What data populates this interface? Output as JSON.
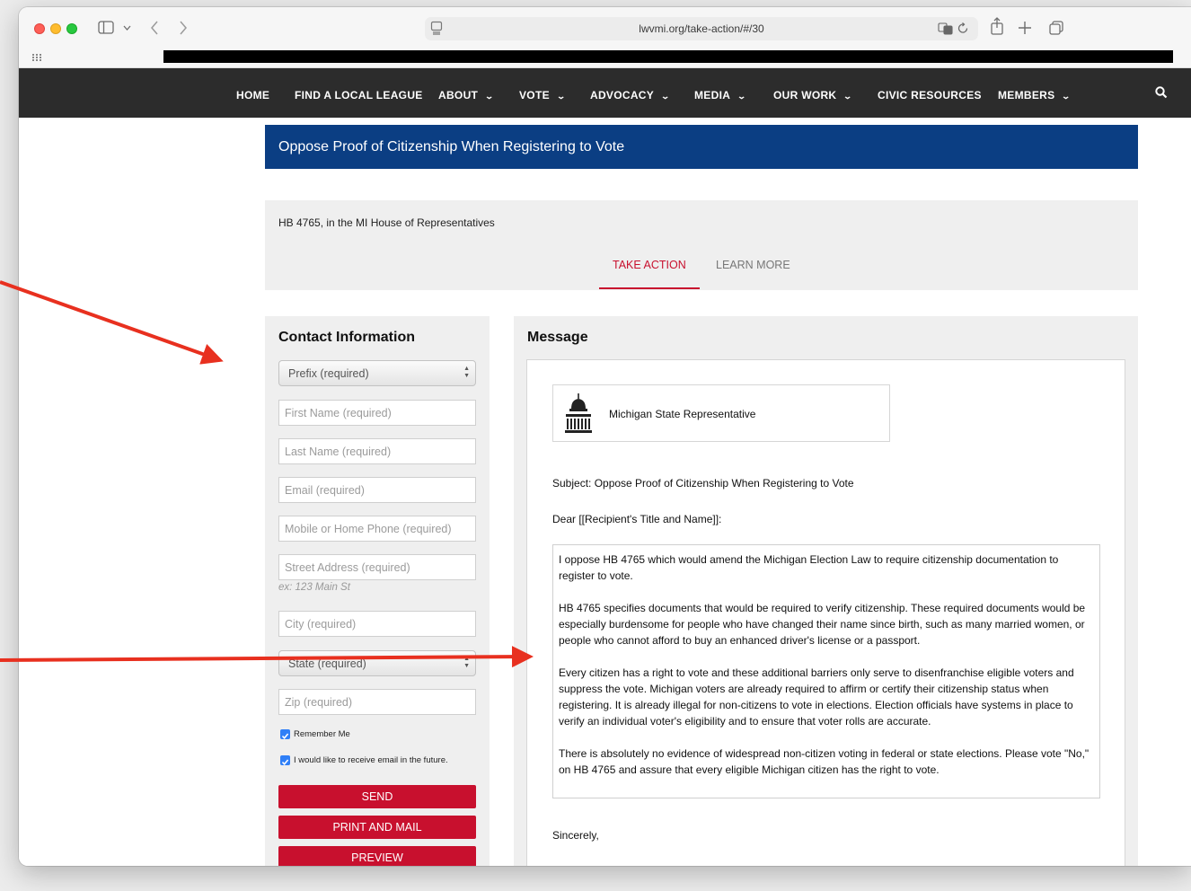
{
  "browser": {
    "url": "lwvmi.org/take-action/#/30",
    "toolbar_icons": [
      "sidebar-icon",
      "chevron-down-icon",
      "back-icon",
      "forward-icon",
      "tabs-overview-icon",
      "translate-icon",
      "reload-icon",
      "share-icon",
      "new-tab-icon",
      "tab-overview-icon"
    ],
    "bookmarks_icon": "grid-icon"
  },
  "nav": {
    "items": [
      {
        "label": "HOME"
      },
      {
        "label": "FIND A LOCAL LEAGUE"
      },
      {
        "label": "ABOUT"
      },
      {
        "label": "VOTE"
      },
      {
        "label": "ADVOCACY"
      },
      {
        "label": "MEDIA"
      },
      {
        "label": "OUR WORK"
      },
      {
        "label": "CIVIC RESOURCES"
      },
      {
        "label": "MEMBERS"
      }
    ],
    "caret": "⌄",
    "search_icon": "search-icon"
  },
  "page": {
    "title": "Oppose Proof of Citizenship When Registering to Vote",
    "bill": "HB 4765, in the MI House of Representatives",
    "tabs": {
      "take_action": "TAKE ACTION",
      "learn_more": "LEARN MORE"
    }
  },
  "contact": {
    "heading": "Contact Information",
    "prefix_placeholder": "Prefix (required)",
    "first_name_placeholder": "First Name (required)",
    "last_name_placeholder": "Last Name (required)",
    "email_placeholder": "Email (required)",
    "phone_placeholder": "Mobile or Home Phone (required)",
    "street_placeholder": "Street Address (required)",
    "street_hint": "ex: 123 Main St",
    "city_placeholder": "City (required)",
    "state_placeholder": "State (required)",
    "zip_placeholder": "Zip (required)",
    "remember_me": "Remember Me",
    "receive_email": "I would like to receive email in the future.",
    "send_label": "SEND",
    "print_label": "PRINT AND MAIL",
    "preview_label": "PREVIEW"
  },
  "message": {
    "heading": "Message",
    "recipient": "Michigan State Representative",
    "subject": "Subject: Oppose Proof of Citizenship When Registering to Vote",
    "salutation": "Dear [[Recipient's Title and Name]]:",
    "paragraphs": [
      "I oppose HB 4765 which would amend the Michigan Election Law to require citizenship documentation to register to vote.",
      "HB 4765 specifies documents that would be required to verify citizenship. These required documents would be especially burdensome for people who have changed their name since birth, such as many married women, or people who cannot afford to buy an enhanced driver's license or a passport.",
      "Every citizen has a right to vote and these additional barriers only serve to disenfranchise eligible voters and suppress the vote.  Michigan voters are already required to affirm or certify their citizenship status when registering. It is already illegal for non-citizens to vote in elections. Election officials have systems in place to verify an individual voter's eligibility and to ensure that voter rolls are accurate.",
      "There is absolutely no evidence of widespread non-citizen voting in federal or state elections. Please vote \"No,\" on HB 4765 and assure that every eligible Michigan citizen has the right to vote."
    ],
    "closing": "Sincerely,"
  },
  "colors": {
    "nav_bg": "#2c2c2c",
    "banner_bg": "#0b3e83",
    "accent_red": "#c8102e",
    "panel_bg": "#efefef",
    "annotation_arrow": "#e8301f"
  }
}
